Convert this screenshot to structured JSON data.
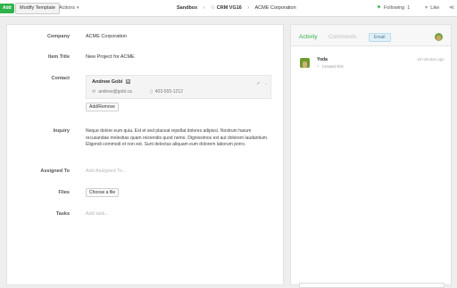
{
  "toolbar": {
    "add_label": "Add",
    "modify_template_label": "Modify Template",
    "actions_label": "Actions"
  },
  "breadcrumb": {
    "workspace": "Sandbox",
    "app": "CRM VG16",
    "record": "ACME Corporation"
  },
  "follow": {
    "label": "Following",
    "count": "1"
  },
  "like": {
    "label": "Like"
  },
  "form": {
    "company": {
      "label": "Company",
      "value": "ACME Corporation"
    },
    "item_title": {
      "label": "Item Title",
      "value": "New Project for ACME"
    },
    "contact": {
      "label": "Contact",
      "name": "Andrew Gobi",
      "linkedin_badge": "in",
      "email": "andrew@gobi.ca",
      "phone": "403-555-1212",
      "add_remove_label": "Add/Remove"
    },
    "inquiry": {
      "label": "Inquiry",
      "value": "Neque dolore eum quia. Est et sed placeat repellat dolores adipisci. Nostrum harum recusandae molestias quam reiciendis quod nemo. Dignissimos est aut dolorem laudantium. Eligendi commodi et non est. Sunt delectus aliquam eum dolorem laborum porro."
    },
    "assigned_to": {
      "label": "Assigned To",
      "placeholder": "Add Assigned To..."
    },
    "files": {
      "label": "Files",
      "button_label": "Choose a file"
    },
    "tasks": {
      "label": "Tasks",
      "placeholder": "Add task..."
    }
  },
  "activity": {
    "tabs": [
      "Activity",
      "Comments"
    ],
    "email_label": "Email",
    "entries": [
      {
        "user": "Yoda",
        "time": "18 minutes ago",
        "action": "Created this"
      }
    ]
  },
  "colors": {
    "accent_green": "#2fb24a",
    "email_badge_bg": "#dff0f8"
  },
  "icons": [
    "chevron-down-icon",
    "tag-icon",
    "flag-icon",
    "heart-icon",
    "share-icon",
    "linkedin-icon",
    "mail-icon",
    "phone-icon",
    "pin-icon",
    "plus-icon"
  ]
}
